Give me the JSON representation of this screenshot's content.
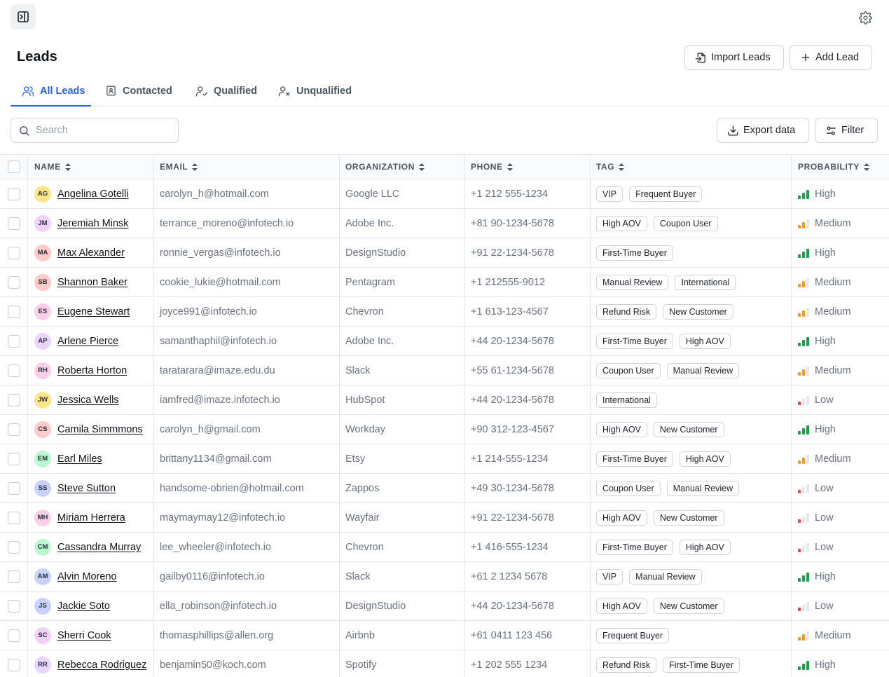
{
  "header": {
    "title": "Leads",
    "import_label": "Import Leads",
    "add_label": "Add Lead"
  },
  "tabs": [
    {
      "label": "All Leads",
      "active": true
    },
    {
      "label": "Contacted",
      "active": false
    },
    {
      "label": "Qualified",
      "active": false
    },
    {
      "label": "Unqualified",
      "active": false
    }
  ],
  "toolbar": {
    "search_placeholder": "Search",
    "export_label": "Export data",
    "filter_label": "Filter"
  },
  "table": {
    "columns": [
      "NAME",
      "EMAIL",
      "ORGANIZATION",
      "PHONE",
      "TAG",
      "PROBABILITY"
    ],
    "probability_colors": {
      "High": "#16a34a",
      "Medium": "#f59e0b",
      "Low": "#ef4444",
      "inactive": "#e5e7eb"
    },
    "rows": [
      {
        "initials": "AG",
        "avatar_color": "#fde68a",
        "name": "Angelina Gotelli",
        "email": "carolyn_h@hotmail.com",
        "organization": "Google LLC",
        "phone": "+1 212 555-1234",
        "tags": [
          "VIP",
          "Frequent Buyer"
        ],
        "probability": "High"
      },
      {
        "initials": "JM",
        "avatar_color": "#f5d0fe",
        "name": "Jeremiah Minsk",
        "email": "terrance_moreno@infotech.io",
        "organization": "Adobe Inc.",
        "phone": "+81 90-1234-5678",
        "tags": [
          "High AOV",
          "Coupon User"
        ],
        "probability": "Medium"
      },
      {
        "initials": "MA",
        "avatar_color": "#fecaca",
        "name": "Max Alexander",
        "email": "ronnie_vergas@infotech.io",
        "organization": "DesignStudio",
        "phone": "+91 22-1234-5678",
        "tags": [
          "First-Time Buyer"
        ],
        "probability": "High"
      },
      {
        "initials": "SB",
        "avatar_color": "#fecaca",
        "name": "Shannon Baker",
        "email": "cookie_lukie@hotmail.com",
        "organization": "Pentagram",
        "phone": "+1 212555-9012",
        "tags": [
          "Manual Review",
          "International"
        ],
        "probability": "Medium"
      },
      {
        "initials": "ES",
        "avatar_color": "#fbcfe8",
        "name": "Eugene Stewart",
        "email": "joyce991@infotech.io",
        "organization": "Chevron",
        "phone": "+1 613-123-4567",
        "tags": [
          "Refund Risk",
          "New Customer"
        ],
        "probability": "Medium"
      },
      {
        "initials": "AP",
        "avatar_color": "#e9d5ff",
        "name": "Arlene Pierce",
        "email": "samanthaphil@infotech.io",
        "organization": "Adobe Inc.",
        "phone": "+44 20-1234-5678",
        "tags": [
          "First-Time Buyer",
          "High AOV"
        ],
        "probability": "High"
      },
      {
        "initials": "RH",
        "avatar_color": "#fbcfe8",
        "name": "Roberta Horton",
        "email": "taratarara@imaze.edu.du",
        "organization": "Slack",
        "phone": "+55 61-1234-5678",
        "tags": [
          "Coupon User",
          "Manual Review"
        ],
        "probability": "Medium"
      },
      {
        "initials": "JW",
        "avatar_color": "#fde68a",
        "name": "Jessica Wells",
        "email": "iamfred@imaze.infotech.io",
        "organization": "HubSpot",
        "phone": "+44 20-1234-5678",
        "tags": [
          "International"
        ],
        "probability": "Low"
      },
      {
        "initials": "CS",
        "avatar_color": "#fecaca",
        "name": "Camila Simmmons",
        "email": "carolyn_h@gmail.com",
        "organization": "Workday",
        "phone": "+90 312-123-4567",
        "tags": [
          "High AOV",
          "New Customer"
        ],
        "probability": "High"
      },
      {
        "initials": "EM",
        "avatar_color": "#bbf7d0",
        "name": "Earl Miles",
        "email": "brittany1134@gmail.com",
        "organization": "Etsy",
        "phone": "+1 214-555-1234",
        "tags": [
          "First-Time Buyer",
          "High AOV"
        ],
        "probability": "Medium"
      },
      {
        "initials": "SS",
        "avatar_color": "#c7d2fe",
        "name": "Steve Sutton",
        "email": "handsome-obrien@hotmail.com",
        "organization": "Zappos",
        "phone": "+49 30-1234-5678",
        "tags": [
          "Coupon User",
          "Manual Review"
        ],
        "probability": "Low"
      },
      {
        "initials": "MH",
        "avatar_color": "#fbcfe8",
        "name": "Miriam Herrera",
        "email": "maymaymay12@infotech.io",
        "organization": "Wayfair",
        "phone": "+91 22-1234-5678",
        "tags": [
          "High AOV",
          "New Customer"
        ],
        "probability": "Low"
      },
      {
        "initials": "CM",
        "avatar_color": "#bbf7d0",
        "name": "Cassandra Murray",
        "email": "lee_wheeler@infotech.io",
        "organization": "Chevron",
        "phone": "+1 416-555-1234",
        "tags": [
          "First-Time Buyer",
          "High AOV"
        ],
        "probability": "Low"
      },
      {
        "initials": "AM",
        "avatar_color": "#c7d2fe",
        "name": "Alvin Moreno",
        "email": "gailby0116@infotech.io",
        "organization": "Slack",
        "phone": "+61 2 1234 5678",
        "tags": [
          "VIP",
          "Manual Review"
        ],
        "probability": "High"
      },
      {
        "initials": "JS",
        "avatar_color": "#c7d2fe",
        "name": "Jackie Soto",
        "email": "ella_robinson@infotech.io",
        "organization": "DesignStudio",
        "phone": "+44 20-1234-5678",
        "tags": [
          "High AOV",
          "New Customer"
        ],
        "probability": "Low"
      },
      {
        "initials": "SC",
        "avatar_color": "#f5d0fe",
        "name": "Sherri Cook",
        "email": "thomasphillips@allen.org",
        "organization": "Airbnb",
        "phone": "+61 0411 123 456",
        "tags": [
          "Frequent Buyer"
        ],
        "probability": "Medium"
      },
      {
        "initials": "RR",
        "avatar_color": "#e9d5ff",
        "name": "Rebecca Rodriguez",
        "email": "benjamin50@koch.com",
        "organization": "Spotify",
        "phone": "+1 202 555 1234",
        "tags": [
          "Refund Risk",
          "First-Time Buyer"
        ],
        "probability": "High"
      }
    ]
  }
}
